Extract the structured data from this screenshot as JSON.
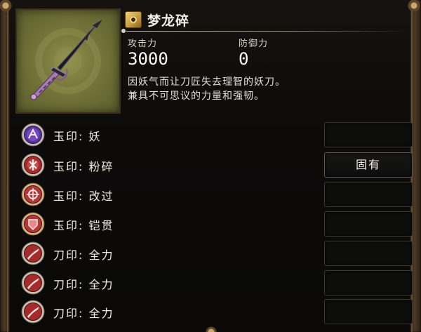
{
  "weapon": {
    "name": "梦龙碎",
    "image_icon": "sword-icon"
  },
  "stats": {
    "attack_label": "攻击力",
    "attack_value": "3000",
    "defense_label": "防御力",
    "defense_value": "0"
  },
  "description": {
    "line1": "因妖气而让刀匠失去理智的妖刀。",
    "line2": "兼具不可思议的力量和强韧。"
  },
  "seals": [
    {
      "name": "玉印: 妖",
      "icon": "purple-demon-seal-icon",
      "color": "#6a3fb2",
      "slot": ""
    },
    {
      "name": "玉印: 粉碎",
      "icon": "red-shatter-seal-icon",
      "color": "#b33a3a",
      "slot": "固有"
    },
    {
      "name": "玉印: 改过",
      "icon": "red-reform-seal-icon",
      "color": "#b33a3a",
      "slot": ""
    },
    {
      "name": "玉印: 铠贯",
      "icon": "red-armor-pierce-seal-icon",
      "color": "#b33a3a",
      "slot": ""
    },
    {
      "name": "刀印: 全力",
      "icon": "red-blade-seal-icon",
      "color": "#b33a3a",
      "slot": ""
    },
    {
      "name": "刀印: 全力",
      "icon": "red-blade-seal-icon",
      "color": "#b33a3a",
      "slot": ""
    },
    {
      "name": "刀印: 全力",
      "icon": "red-blade-seal-icon",
      "color": "#b33a3a",
      "slot": ""
    }
  ]
}
